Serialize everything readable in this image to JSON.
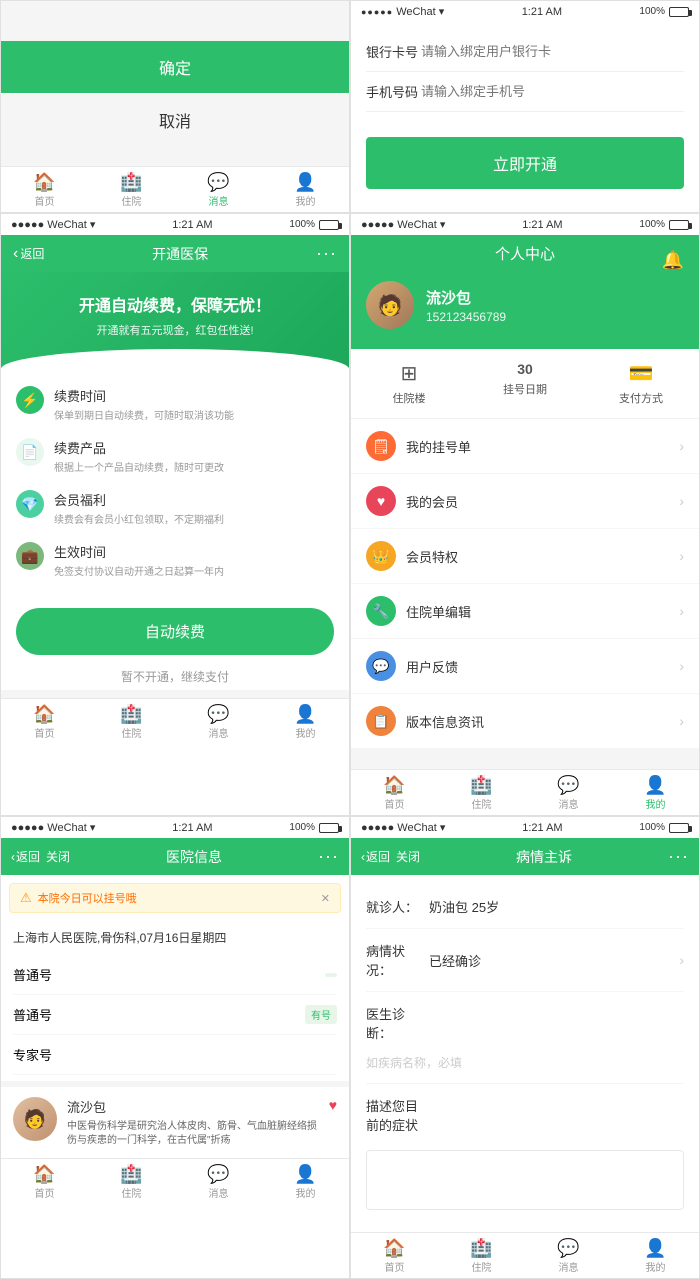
{
  "panels": {
    "confirm": {
      "confirm_btn": "确定",
      "cancel_btn": "取消",
      "tabs": [
        "首页",
        "住院",
        "消息",
        "我的"
      ],
      "active_tab": 2
    },
    "bank": {
      "title": "开通医保",
      "bank_card_label": "银行卡号",
      "bank_card_placeholder": "请输入绑定用户银行卡",
      "phone_label": "手机号码",
      "phone_placeholder": "请输入绑定手机号",
      "open_btn": "立即开通"
    },
    "renew": {
      "status_left": "●●●●● WeChat",
      "status_time": "1:21 AM",
      "status_battery": "100%",
      "nav_back": "返回",
      "nav_title": "开通医保",
      "banner_title": "开通自动续费，保障无忧！",
      "banner_sub": "开通就有五元现金，红包任性送!",
      "features": [
        {
          "icon": "⚡",
          "color": "green",
          "title": "续费时间",
          "desc": "保单到期日自动续费，可随时取消该功能"
        },
        {
          "icon": "📄",
          "color": "light-green",
          "title": "续费产品",
          "desc": "根据上一个产品自动续费，随时可更改"
        },
        {
          "icon": "💎",
          "color": "teal",
          "title": "会员福利",
          "desc": "续费会有会员小红包领取，不定期福利"
        },
        {
          "icon": "💼",
          "color": "olive",
          "title": "生效时间",
          "desc": "免签支付协议自动开通之日起算一年内"
        }
      ],
      "auto_btn": "自动续费",
      "skip_text": "暂不开通，继续支付",
      "tabs": [
        "首页",
        "住院",
        "消息",
        "我的"
      ]
    },
    "profile": {
      "status_left": "●●●●● WeChat",
      "status_time": "1:21 AM",
      "status_battery": "100%",
      "title": "个人中心",
      "name": "流沙包",
      "phone": "152123456789",
      "quick_nav": [
        {
          "icon": "⊞",
          "label": "住院楼"
        },
        {
          "icon": "30",
          "label": "挂号日期"
        },
        {
          "icon": "💳",
          "label": "支付方式"
        }
      ],
      "menu_items": [
        {
          "icon": "🗒",
          "color": "orange",
          "label": "我的挂号单"
        },
        {
          "icon": "♥",
          "color": "red",
          "label": "我的会员"
        },
        {
          "icon": "👑",
          "color": "yellow",
          "label": "会员特权"
        },
        {
          "icon": "🔧",
          "color": "green",
          "label": "住院单编辑"
        },
        {
          "icon": "💬",
          "color": "blue",
          "label": "用户反馈"
        },
        {
          "icon": "📋",
          "color": "orange2",
          "label": "版本信息资讯"
        }
      ],
      "tabs": [
        "首页",
        "住院",
        "消息",
        "我的"
      ],
      "active_tab": 3
    },
    "hospital": {
      "status_left": "●●●●● WeChat",
      "status_time": "1:21 AM",
      "status_battery": "100%",
      "nav_back": "返回",
      "nav_close": "关闭",
      "nav_title": "医院信息",
      "notice": "本院今日可以挂号哦",
      "hospital_name": "上海市人民医院,骨伤科,07月16日星期四",
      "departments": [
        {
          "name": "普通号",
          "badge": "",
          "extra": ""
        },
        {
          "name": "普通号",
          "badge": "有号",
          "extra": ""
        },
        {
          "name": "专家号",
          "badge": "",
          "extra": ""
        }
      ],
      "doctor_name": "流沙包",
      "doctor_dept": "中医骨伤科学是研究治人体皮肉、筋骨、气血脏腑经络损伤与疾患的一门科学，在古代属\"折疡",
      "tabs": [
        "首页",
        "住院",
        "消息",
        "我的"
      ]
    },
    "complaint": {
      "status_left": "●●●●● WeChat",
      "status_time": "1:21 AM",
      "status_battery": "100%",
      "nav_back": "返回",
      "nav_close": "关闭",
      "nav_title": "病情主诉",
      "patient_label": "就诊人：",
      "patient_value": "奶油包  25岁",
      "condition_label": "病情状况：",
      "condition_value": "已经确诊",
      "diagnosis_label": "医生诊断：",
      "diagnosis_placeholder": "如疾病名称，必填",
      "desc_label": "描述您目前的症状",
      "tabs": [
        "首页",
        "住院",
        "消息",
        "我的"
      ]
    }
  }
}
